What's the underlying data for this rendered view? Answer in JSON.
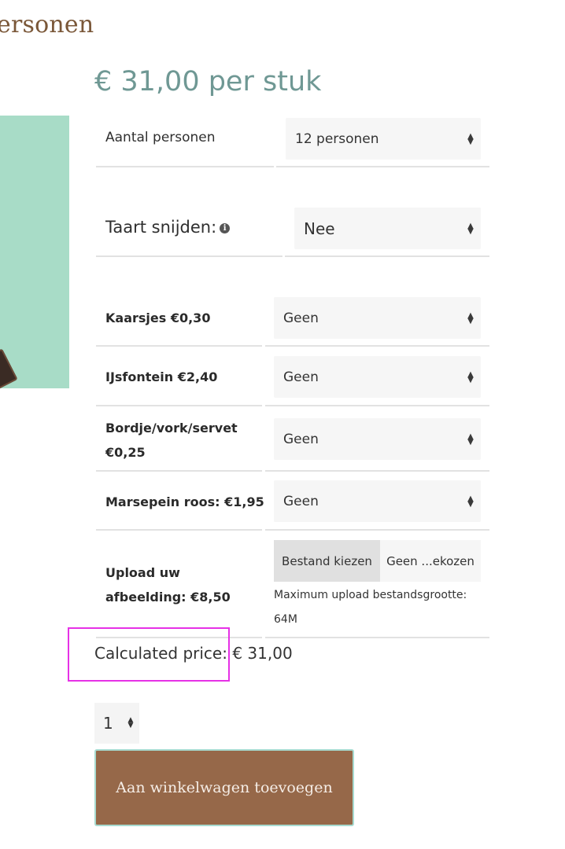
{
  "product": {
    "title_fragment": "ersonen",
    "price_text": "€ 31,00 per stuk"
  },
  "options": {
    "aantal": {
      "label": "Aantal personen",
      "value": "12 personen"
    },
    "taart": {
      "label": "Taart snijden:",
      "value": "Nee"
    },
    "kaarsjes": {
      "label": "Kaarsjes €0,30",
      "value": "Geen"
    },
    "ijsfontein": {
      "label": "IJsfontein €2,40",
      "value": "Geen"
    },
    "bordje": {
      "label_line1": "Bordje/vork/servet",
      "label_line2": "€0,25",
      "value": "Geen"
    },
    "marsepein": {
      "label": "Marsepein roos: €1,95",
      "value": "Geen"
    },
    "upload": {
      "label_line1": "Upload uw",
      "label_line2": "afbeelding: €8,50",
      "button": "Bestand kiezen",
      "status": "Geen ...ekozen",
      "note_line1": "Maximum upload bestandsgrootte:",
      "note_line2": "64M"
    }
  },
  "calculated": {
    "label": "Calculated price:",
    "value": "€ 31,00"
  },
  "quantity": {
    "value": "1"
  },
  "cart": {
    "button": "Aan winkelwagen toevoegen"
  },
  "colors": {
    "accent_brown": "#966849",
    "price_teal": "#6f9894",
    "image_mint": "#a8dcc7",
    "highlight_magenta": "#e631e6"
  },
  "icons": {
    "info": "info-icon",
    "select_arrows": "updown-arrows-icon"
  }
}
